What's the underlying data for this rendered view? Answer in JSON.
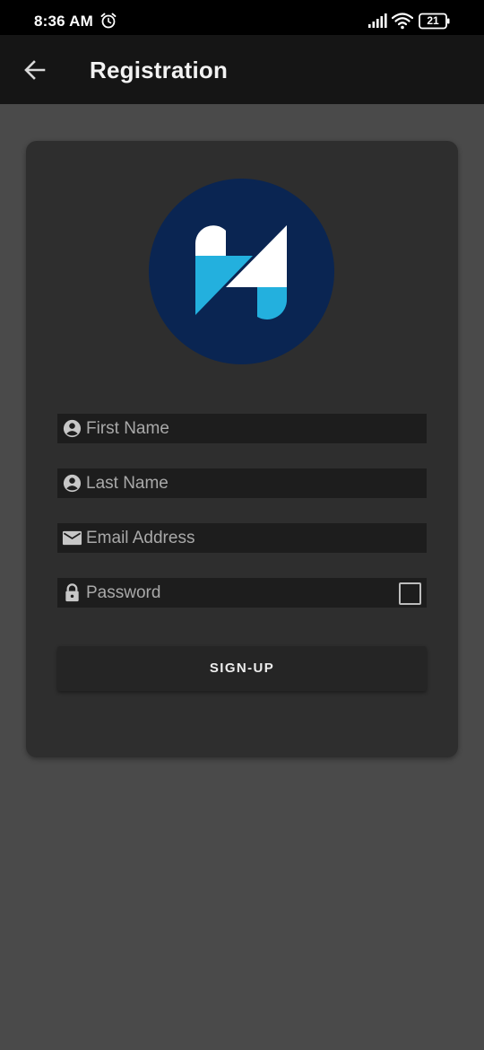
{
  "status_bar": {
    "time": "8:36 AM",
    "battery_level": "21",
    "icons": [
      "alarm-icon",
      "signal-icon",
      "wifi-icon",
      "battery-icon"
    ]
  },
  "app_bar": {
    "title": "Registration",
    "back_icon": "arrow-left-icon"
  },
  "form": {
    "fields": [
      {
        "placeholder": "First Name",
        "icon": "person-icon",
        "value": ""
      },
      {
        "placeholder": "Last Name",
        "icon": "person-icon",
        "value": ""
      },
      {
        "placeholder": "Email Address",
        "icon": "mail-icon",
        "value": ""
      },
      {
        "placeholder": "Password",
        "icon": "lock-icon",
        "value": "",
        "show_password_checked": false
      }
    ],
    "submit_label": "SIGN-UP"
  },
  "colors": {
    "background": "#4a4a4a",
    "card": "#2e2e2e",
    "app_bar": "#151515",
    "logo_circle": "#0a2552",
    "logo_blue": "#23b0de",
    "logo_white": "#ffffff"
  }
}
